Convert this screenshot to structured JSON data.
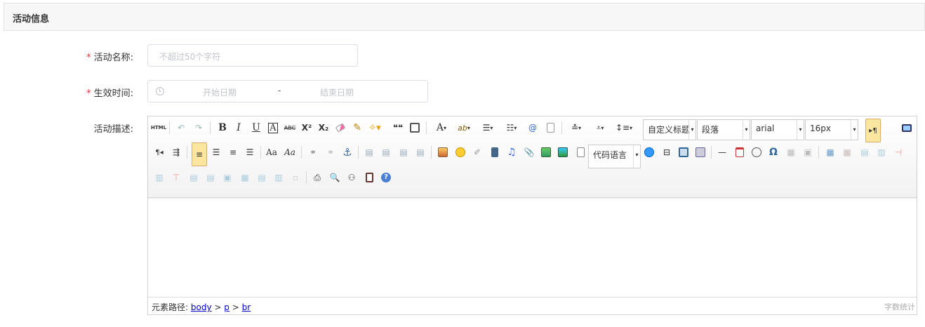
{
  "section": {
    "title": "活动信息"
  },
  "form": {
    "name": {
      "required_mark": "*",
      "label": "活动名称:",
      "placeholder": "不超过50个字符"
    },
    "time": {
      "required_mark": "*",
      "label": "生效时间:",
      "start_placeholder": "开始日期",
      "separator": "-",
      "end_placeholder": "结束日期"
    },
    "desc": {
      "label": "活动描述:"
    }
  },
  "editor": {
    "combos": {
      "custom_title": "自定义标题",
      "paragraph": "段落",
      "font": "arial",
      "size": "16px",
      "code_lang": "代码语言"
    },
    "glyphs": {
      "html": "HTML",
      "bold": "B",
      "italic": "I",
      "underline": "U",
      "border": "A",
      "strike": "ABC",
      "sup": "X²",
      "sub": "X₂",
      "quote": "❝❝",
      "forecolor": "A",
      "backcolor": "ab",
      "ltr": "¶◂",
      "rtl": "▸¶",
      "pilcrow": "▸¶",
      "omega": "Ω",
      "hr": "—",
      "help": "?"
    },
    "status": {
      "path_label": "元素路径:",
      "path": [
        "body",
        "p",
        "br"
      ],
      "path_sep": ">",
      "wordcount": "字数统计"
    }
  },
  "colors": {
    "required": "#e4393c",
    "active_bg": "#ffe69f",
    "link": "#0000cc"
  }
}
